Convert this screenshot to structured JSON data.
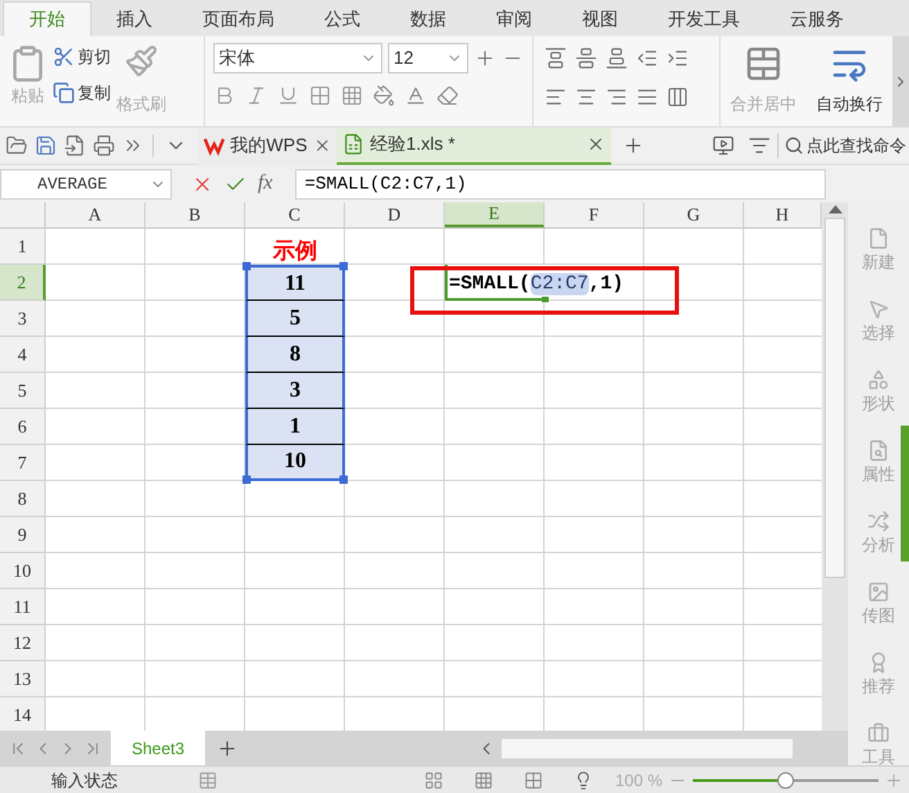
{
  "menu_tabs": [
    {
      "label": "开始",
      "selected": true
    },
    {
      "label": "插入",
      "selected": false
    },
    {
      "label": "页面布局",
      "selected": false
    },
    {
      "label": "公式",
      "selected": false
    },
    {
      "label": "数据",
      "selected": false
    },
    {
      "label": "审阅",
      "selected": false
    },
    {
      "label": "视图",
      "selected": false
    },
    {
      "label": "开发工具",
      "selected": false
    },
    {
      "label": "云服务",
      "selected": false
    }
  ],
  "ribbon": {
    "paste": {
      "label": "粘贴",
      "disabled": true
    },
    "cut": {
      "label": "剪切",
      "disabled": false
    },
    "copy": {
      "label": "复制",
      "disabled": false
    },
    "format_painter": {
      "label": "格式刷",
      "disabled": true
    },
    "font_name": "宋体",
    "font_size": "12",
    "merge": {
      "label": "合并居中",
      "disabled": true
    },
    "wrap": {
      "label": "自动换行",
      "disabled": false
    }
  },
  "doc_tabs": [
    {
      "label": "我的WPS",
      "selected": false
    },
    {
      "label": "经验1.xls *",
      "selected": true
    }
  ],
  "command_search": "点此查找命令",
  "name_box": "AVERAGE",
  "function_label": "fx",
  "formula": "=SMALL(C2:C7,1)",
  "columns": [
    {
      "label": "A",
      "selected": false
    },
    {
      "label": "B",
      "selected": false
    },
    {
      "label": "C",
      "selected": false
    },
    {
      "label": "D",
      "selected": false
    },
    {
      "label": "E",
      "selected": true
    },
    {
      "label": "F",
      "selected": false
    },
    {
      "label": "G",
      "selected": false
    },
    {
      "label": "H",
      "selected": false
    }
  ],
  "rows": [
    {
      "label": "1",
      "selected": false,
      "cells": [
        null,
        null,
        {
          "kind": "title",
          "text": "示例"
        },
        null,
        null,
        null,
        null,
        null
      ]
    },
    {
      "label": "2",
      "selected": true,
      "cells": [
        null,
        null,
        {
          "kind": "range",
          "text": "11"
        },
        null,
        {
          "kind": "editing",
          "before": "=SMALL(",
          "reference": "C2:C7",
          "after": ",1)"
        },
        null,
        null,
        null
      ]
    },
    {
      "label": "3",
      "selected": false,
      "cells": [
        null,
        null,
        {
          "kind": "range",
          "text": "5"
        },
        null,
        null,
        null,
        null,
        null
      ]
    },
    {
      "label": "4",
      "selected": false,
      "cells": [
        null,
        null,
        {
          "kind": "range",
          "text": "8"
        },
        null,
        null,
        null,
        null,
        null
      ]
    },
    {
      "label": "5",
      "selected": false,
      "cells": [
        null,
        null,
        {
          "kind": "range",
          "text": "3"
        },
        null,
        null,
        null,
        null,
        null
      ]
    },
    {
      "label": "6",
      "selected": false,
      "cells": [
        null,
        null,
        {
          "kind": "range",
          "text": "1"
        },
        null,
        null,
        null,
        null,
        null
      ]
    },
    {
      "label": "7",
      "selected": false,
      "cells": [
        null,
        null,
        {
          "kind": "range",
          "text": "10"
        },
        null,
        null,
        null,
        null,
        null
      ]
    },
    {
      "label": "8",
      "selected": false,
      "cells": [
        null,
        null,
        null,
        null,
        null,
        null,
        null,
        null
      ]
    },
    {
      "label": "9",
      "selected": false,
      "cells": [
        null,
        null,
        null,
        null,
        null,
        null,
        null,
        null
      ]
    },
    {
      "label": "10",
      "selected": false,
      "cells": [
        null,
        null,
        null,
        null,
        null,
        null,
        null,
        null
      ]
    },
    {
      "label": "11",
      "selected": false,
      "cells": [
        null,
        null,
        null,
        null,
        null,
        null,
        null,
        null
      ]
    },
    {
      "label": "12",
      "selected": false,
      "cells": [
        null,
        null,
        null,
        null,
        null,
        null,
        null,
        null
      ]
    },
    {
      "label": "13",
      "selected": false,
      "cells": [
        null,
        null,
        null,
        null,
        null,
        null,
        null,
        null
      ]
    },
    {
      "label": "14",
      "selected": false,
      "cells": [
        null,
        null,
        null,
        null,
        null,
        null,
        null,
        null
      ]
    }
  ],
  "sidebar_tools": [
    "新建",
    "选择",
    "形状",
    "属性",
    "分析",
    "传图",
    "推荐",
    "工具"
  ],
  "sheet_tabs": [
    {
      "label": "Sheet3",
      "selected": true
    }
  ],
  "status_bar": {
    "mode": "输入状态",
    "zoom": "100 %",
    "zoom_slider": {
      "level": 0.5
    }
  }
}
